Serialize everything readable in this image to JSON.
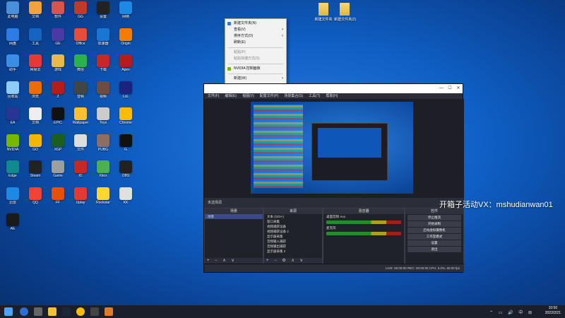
{
  "desktop": {
    "icons": [
      {
        "label": "此电脑",
        "color": "#4a90d9"
      },
      {
        "label": "文档",
        "color": "#f2a33a"
      },
      {
        "label": "软件",
        "color": "#d9534f"
      },
      {
        "label": "GG",
        "color": "#c0392b"
      },
      {
        "label": "设置",
        "color": "#222"
      },
      {
        "label": "网络",
        "color": "#1e88e5"
      },
      {
        "label": "网盘",
        "color": "#2d7be5"
      },
      {
        "label": "工具",
        "color": "#1565c0"
      },
      {
        "label": "GE",
        "color": "#4b3aa3"
      },
      {
        "label": "Office",
        "color": "#e74c3c"
      },
      {
        "label": "加速器",
        "color": "#1976d2"
      },
      {
        "label": "Origin",
        "color": "#f57c00"
      },
      {
        "label": "助手",
        "color": "#3a8ee6"
      },
      {
        "label": "网易云",
        "color": "#e53935"
      },
      {
        "label": "游戏",
        "color": "#e9b949"
      },
      {
        "label": "微信",
        "color": "#2bb24c"
      },
      {
        "label": "下载",
        "color": "#c62828"
      },
      {
        "label": "Apex",
        "color": "#b71c1c"
      },
      {
        "label": "回收站",
        "color": "#90caf9"
      },
      {
        "label": "浏览",
        "color": "#ef6c00"
      },
      {
        "label": "2",
        "color": "#b71c1c"
      },
      {
        "label": "音频",
        "color": "#444"
      },
      {
        "label": "视频",
        "color": "#6d4c41"
      },
      {
        "label": "LoL",
        "color": "#1a237e"
      },
      {
        "label": "EA",
        "color": "#283593"
      },
      {
        "label": "文档",
        "color": "#eee"
      },
      {
        "label": "EPIC",
        "color": "#111"
      },
      {
        "label": "Wallpaper",
        "color": "#fbc02d"
      },
      {
        "label": "Toys",
        "color": "#ccc"
      },
      {
        "label": "Chrome",
        "color": "#fbbc05"
      },
      {
        "label": "NVIDIA",
        "color": "#76b900"
      },
      {
        "label": "GO",
        "color": "#f2b705"
      },
      {
        "label": "XGP",
        "color": "#1b5e20"
      },
      {
        "label": "文件",
        "color": "#ddd"
      },
      {
        "label": "PUBG",
        "color": "#8d6e63"
      },
      {
        "label": "G",
        "color": "#111"
      },
      {
        "label": "Edge",
        "color": "#0f8b8d"
      },
      {
        "label": "Steam",
        "color": "#222"
      },
      {
        "label": "Game",
        "color": "#9e9e9e"
      },
      {
        "label": "红",
        "color": "#c62828"
      },
      {
        "label": "Xbox",
        "color": "#4caf50"
      },
      {
        "label": "OBS",
        "color": "#222"
      },
      {
        "label": "迅雷",
        "color": "#1e88e5"
      },
      {
        "label": "QQ",
        "color": "#f44336"
      },
      {
        "label": "FF",
        "color": "#e65100"
      },
      {
        "label": "Uplay",
        "color": "#e53935"
      },
      {
        "label": "Rockstar",
        "color": "#fdd835"
      },
      {
        "label": "KK",
        "color": "#e0e0e0"
      },
      {
        "label": "AE",
        "color": "#1a1a1a"
      }
    ],
    "folders": [
      {
        "label": "新建文件夹"
      },
      {
        "label": "新建文件夹(2)"
      }
    ]
  },
  "context_menu": {
    "items": [
      {
        "label": "新建文件夹(N)",
        "disabled": false,
        "submenu": false,
        "icon_color": "#2d7be5"
      },
      {
        "label": "查看(V)",
        "disabled": false,
        "submenu": true
      },
      {
        "label": "排序方式(O)",
        "disabled": false,
        "submenu": true
      },
      {
        "label": "刷新(E)",
        "disabled": false,
        "submenu": false
      },
      {
        "sep": true
      },
      {
        "label": "粘贴(P)",
        "disabled": true,
        "submenu": false
      },
      {
        "label": "粘贴快捷方式(S)",
        "disabled": true,
        "submenu": false
      },
      {
        "sep": true
      },
      {
        "label": "NVIDIA 控制面板",
        "disabled": false,
        "submenu": false,
        "icon_color": "#76b900"
      },
      {
        "sep": true
      },
      {
        "label": "新建(W)",
        "disabled": false,
        "submenu": true
      },
      {
        "sep": true
      },
      {
        "label": "显示设置(D)",
        "disabled": false,
        "submenu": false,
        "icon_color": "#2d7be5"
      },
      {
        "label": "个性化(R)",
        "disabled": false,
        "submenu": false,
        "icon_color": "#2d7be5"
      }
    ]
  },
  "obs": {
    "menu": [
      "文件(F)",
      "编辑(E)",
      "视图(V)",
      "配置文件(P)",
      "场景集合(S)",
      "工具(T)",
      "帮助(H)"
    ],
    "status_left": "未选择源",
    "docks": {
      "scenes": {
        "title": "场景",
        "items": [
          "场景"
        ]
      },
      "sources": {
        "title": "来源",
        "items": [
          "文本 (GDI+)",
          "窗口采集",
          "视频捕获设备",
          "视频捕获设备 2",
          "显示器采集",
          "音频输入捕获",
          "音频输出捕获",
          "显示器采集 2"
        ]
      },
      "mixer": {
        "title": "混音器",
        "tracks": [
          "桌面音频 Aux",
          "麦克风"
        ]
      },
      "transitions": {
        "title": "转场"
      },
      "controls": {
        "title": "控件",
        "buttons": [
          "停止推流",
          "开始录制",
          "启动虚拟摄像机",
          "工作室模式",
          "设置",
          "退出"
        ]
      }
    },
    "tabs": [
      "控件",
      "场景转场"
    ],
    "statusbar": "LIVE: 00:00:00   REC: 00:00:00   CPU: 5.0%, 60.00 fps"
  },
  "overlay_text": "开箱子活动VX：mshudianwan01",
  "taskbar": {
    "time": "10:50",
    "date": "2022/2/21"
  }
}
